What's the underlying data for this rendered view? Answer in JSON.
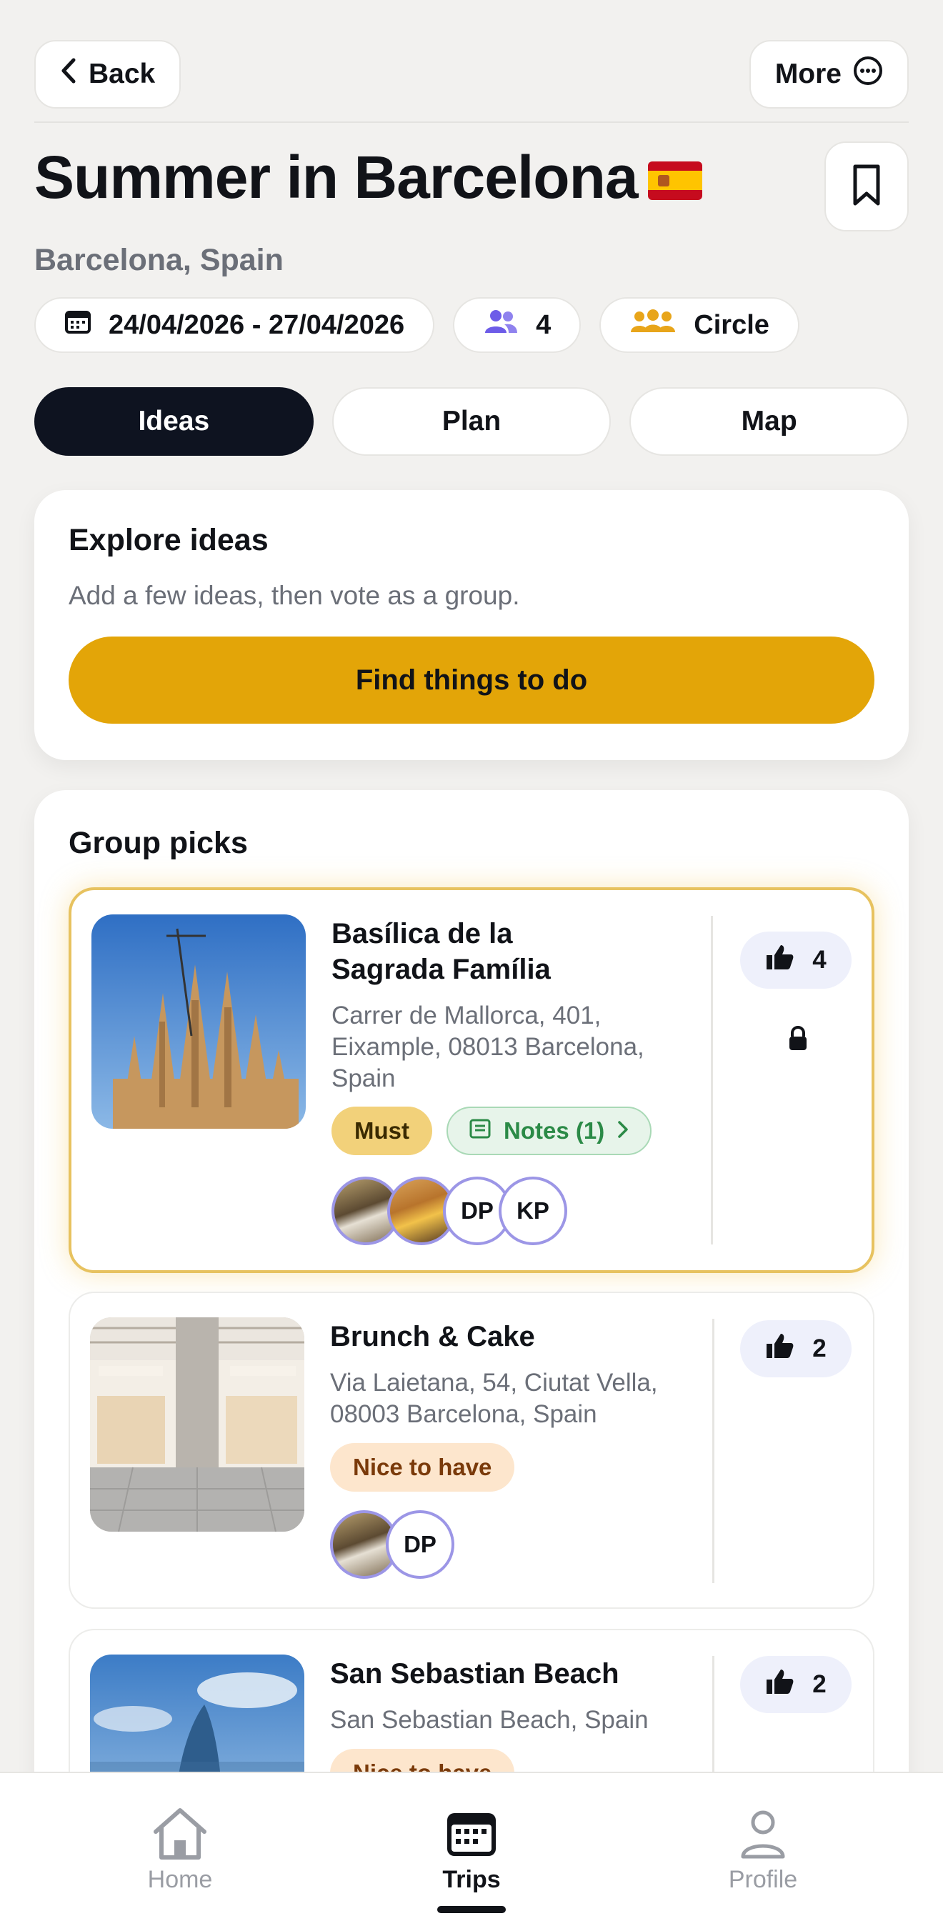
{
  "header": {
    "back_label": "Back",
    "more_label": "More",
    "title": "Summer in Barcelona",
    "flag_icon": "spain-flag-icon",
    "location": "Barcelona, Spain"
  },
  "chips": {
    "dates": "24/04/2026 - 27/04/2026",
    "members": "4",
    "circle": "Circle"
  },
  "tabs": [
    {
      "label": "Ideas",
      "active": true
    },
    {
      "label": "Plan",
      "active": false
    },
    {
      "label": "Map",
      "active": false
    }
  ],
  "explore": {
    "title": "Explore ideas",
    "subtitle": "Add a few ideas, then vote as a group.",
    "button_label": "Find things to do"
  },
  "group_picks": {
    "title": "Group picks",
    "items": [
      {
        "name_line1": "Basílica de la",
        "name_line2": "Sagrada Família",
        "address_line1": "Carrer de Mallorca, 401,",
        "address_line2": "Eixample, 08013 Barcelona,",
        "address_line3": "Spain",
        "priority": "Must",
        "notes": "Notes (1)",
        "votes": "4",
        "locked": true,
        "avatars": [
          "photo",
          "photo",
          "DP",
          "KP"
        ]
      },
      {
        "name_line1": "Brunch & Cake",
        "address_line1": "Via Laietana, 54, Ciutat Vella,",
        "address_line2": "08003 Barcelona, Spain",
        "priority": "Nice to have",
        "votes": "2",
        "avatars": [
          "photo",
          "DP"
        ]
      },
      {
        "name_line1": "San Sebastian Beach",
        "address_line1": "San Sebastian Beach, Spain",
        "priority": "Nice to have",
        "votes": "2"
      }
    ]
  },
  "bottom_nav": {
    "home": "Home",
    "trips": "Trips",
    "profile": "Profile",
    "active": "Trips"
  },
  "colors": {
    "accent_yellow": "#e3a508",
    "dark": "#0e1320",
    "must_tag": "#f2d17a",
    "notes_green": "#2b8a47",
    "avatar_border": "#9c96e6"
  }
}
